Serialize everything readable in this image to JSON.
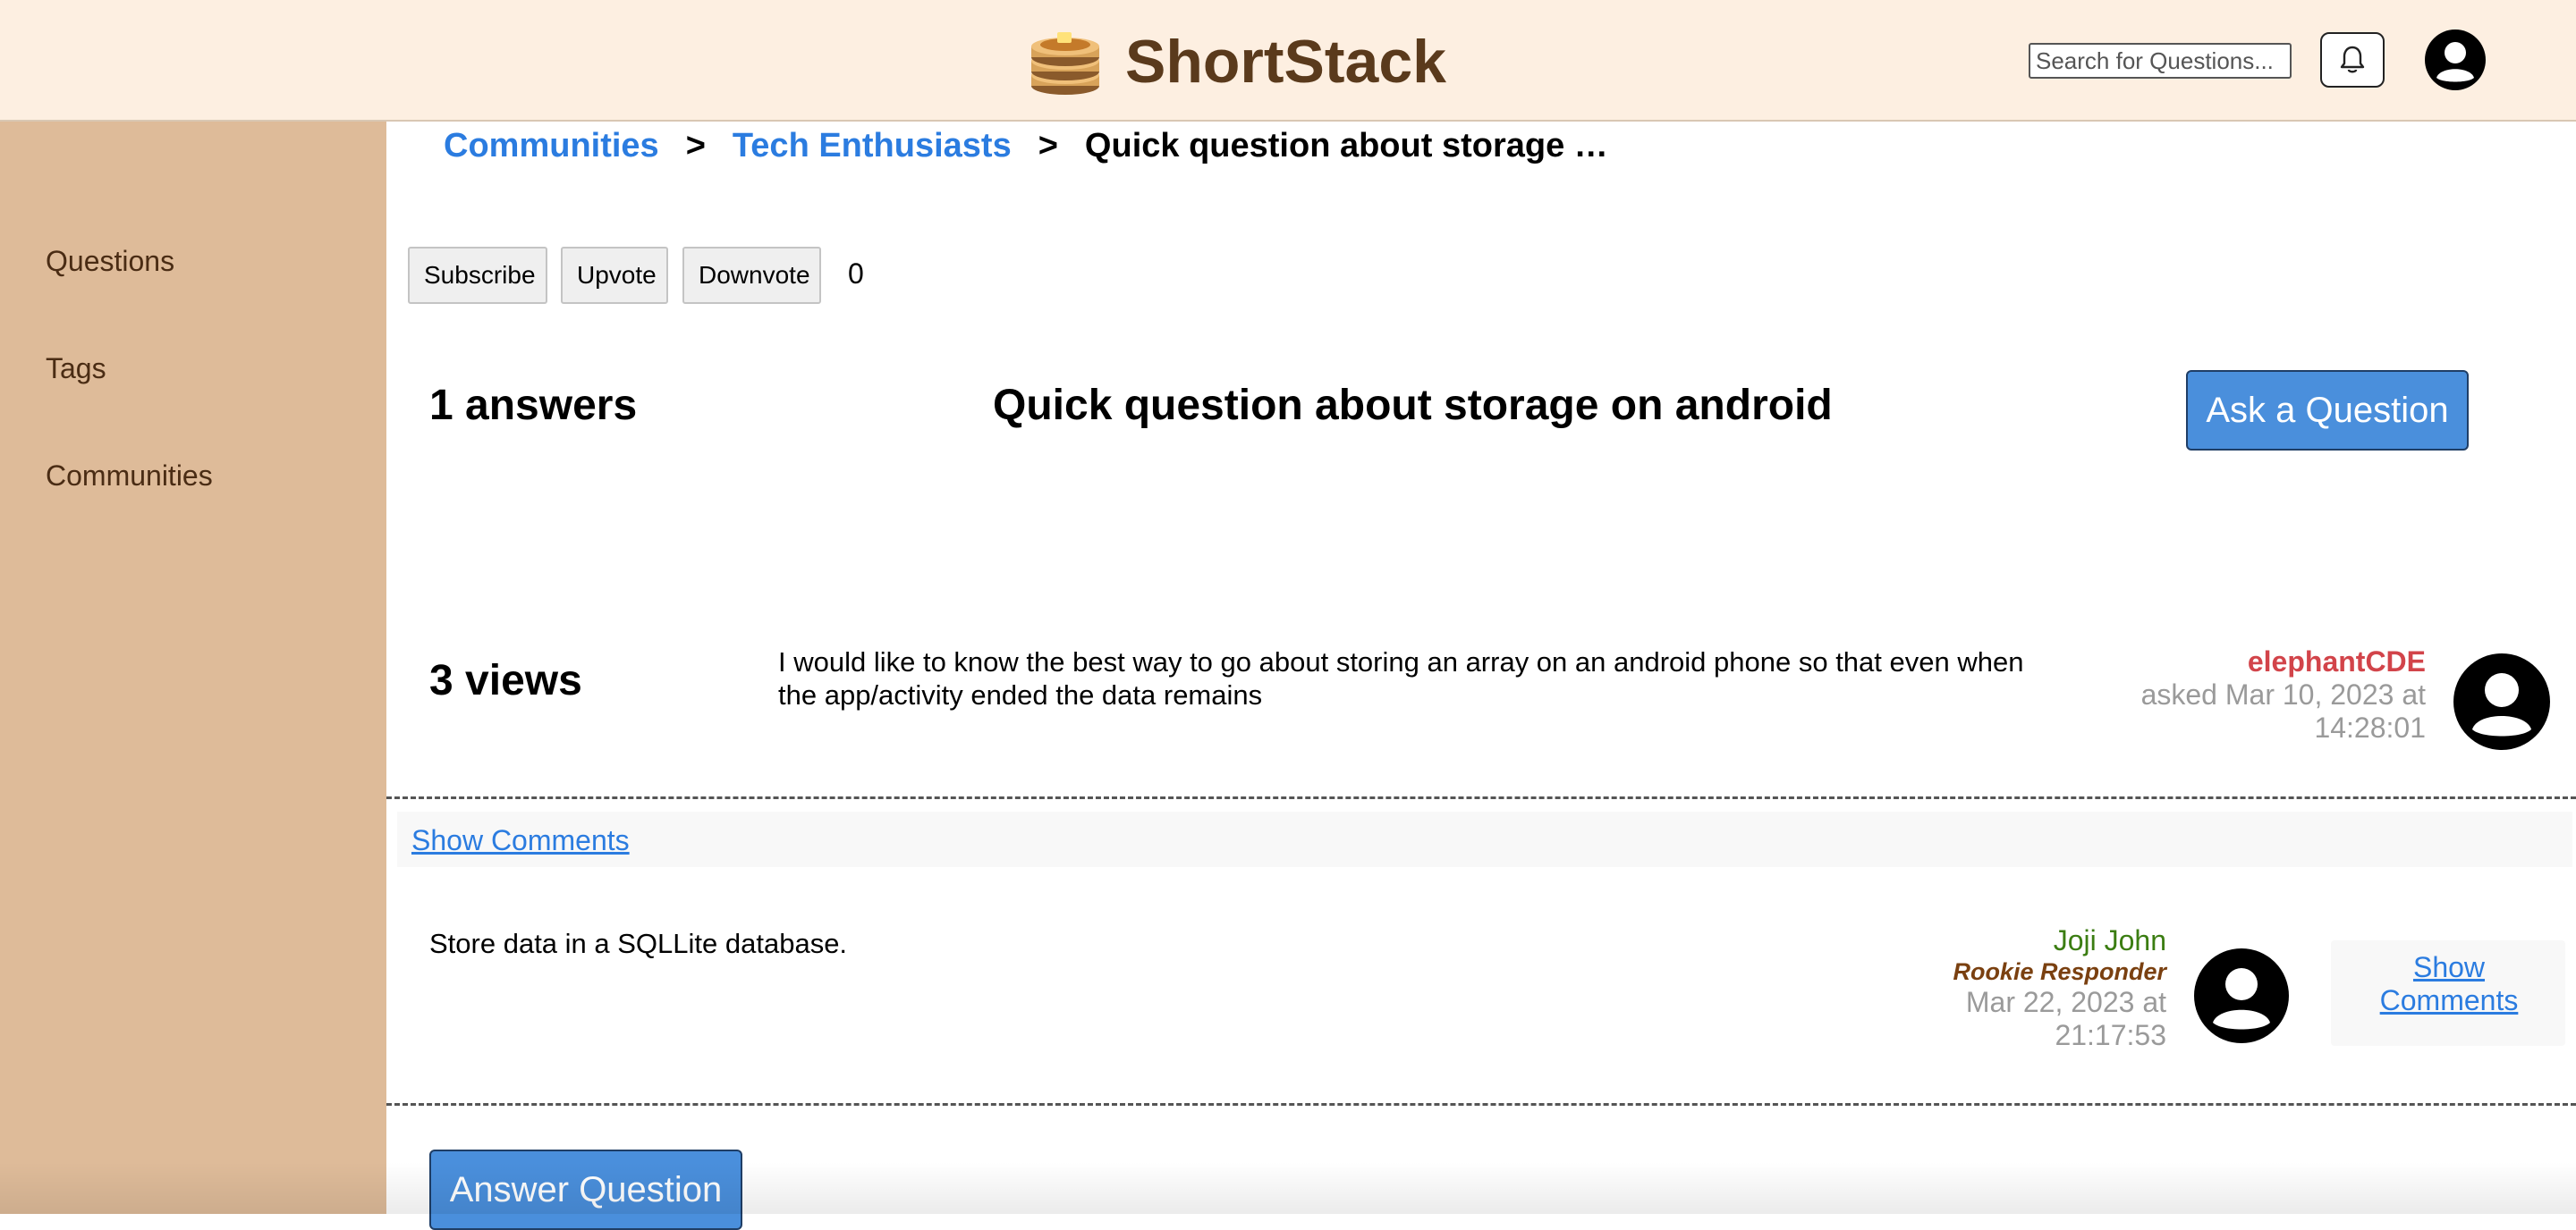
{
  "header": {
    "brand": "ShortStack",
    "search_placeholder": "Search for Questions...",
    "icons": {
      "logo": "pancake-stack-icon",
      "notifications": "bell-icon",
      "profile": "user-avatar-icon"
    }
  },
  "sidebar": {
    "items": [
      {
        "label": "Questions"
      },
      {
        "label": "Tags"
      },
      {
        "label": "Communities"
      }
    ]
  },
  "breadcrumb": {
    "items": [
      {
        "label": "Communities",
        "link": true
      },
      {
        "label": "Tech Enthusiasts",
        "link": true
      },
      {
        "label": "Quick question about storage …",
        "link": false
      }
    ],
    "separator": ">"
  },
  "actions": {
    "subscribe": "Subscribe",
    "upvote": "Upvote",
    "downvote": "Downvote",
    "vote_count": "0"
  },
  "question": {
    "answers_count": "1 answers",
    "title": "Quick question about storage on android",
    "views": "3 views",
    "text": "I would like to know the best way to go about storing an array on an android phone so that even when the app/activity ended the data remains",
    "author": "elephantCDE",
    "asked_line1": "asked Mar 10, 2023 at",
    "asked_line2": "14:28:01",
    "show_comments": "Show Comments"
  },
  "ask_button": "Ask a Question",
  "answers": [
    {
      "text": "Store data in a SQLLite database.",
      "author": "Joji John",
      "badge": "Rookie Responder",
      "date_line1": "Mar 22, 2023 at",
      "date_line2": "21:17:53",
      "show_comments_line1": "Show",
      "show_comments_line2": "Comments"
    }
  ],
  "answer_button": "Answer Question",
  "colors": {
    "header_bg": "#fdefe1",
    "sidebar_bg": "#debb99",
    "link": "#2b7ce0",
    "primary_button": "#4a8fdc",
    "question_author": "#d2444a",
    "answer_author": "#3b7d12",
    "badge": "#7a4010"
  }
}
